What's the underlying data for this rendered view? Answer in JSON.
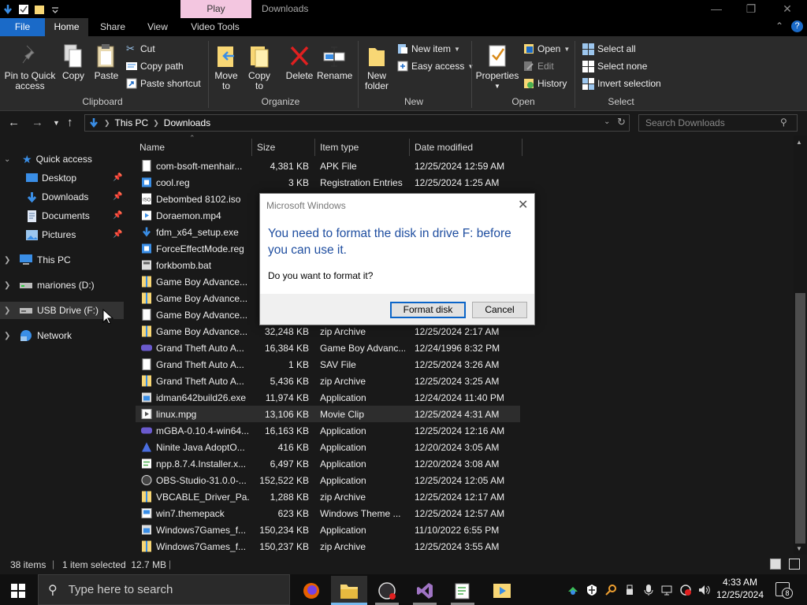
{
  "titlebar": {
    "context_tab": "Play",
    "window_title": "Downloads",
    "controls": [
      "minimize-icon",
      "restore-icon",
      "close-icon"
    ]
  },
  "tabs": {
    "file": "File",
    "home": "Home",
    "share": "Share",
    "view": "View",
    "video_tools": "Video Tools"
  },
  "ribbon": {
    "clipboard": {
      "group": "Clipboard",
      "pin_label": "Pin to Quick access",
      "pin_line1": "Pin to Quick",
      "pin_line2": "access",
      "copy": "Copy",
      "paste": "Paste",
      "cut": "Cut",
      "copy_path": "Copy path",
      "paste_shortcut": "Paste shortcut"
    },
    "organize": {
      "group": "Organize",
      "move_to_1": "Move",
      "move_to_2": "to",
      "copy_to_1": "Copy",
      "copy_to_2": "to",
      "delete": "Delete",
      "rename": "Rename"
    },
    "new": {
      "group": "New",
      "new_folder_1": "New",
      "new_folder_2": "folder",
      "new_item": "New item",
      "easy_access": "Easy access"
    },
    "open": {
      "group": "Open",
      "properties": "Properties",
      "open": "Open",
      "edit": "Edit",
      "history": "History"
    },
    "select": {
      "group": "Select",
      "select_all": "Select all",
      "select_none": "Select none",
      "invert": "Invert selection"
    }
  },
  "address": {
    "crumbs": [
      "This PC",
      "Downloads"
    ],
    "search_placeholder": "Search Downloads"
  },
  "sidebar": {
    "quick_access": "Quick access",
    "items": [
      {
        "label": "Desktop",
        "icon": "desktop-icon",
        "pinned": true
      },
      {
        "label": "Downloads",
        "icon": "download-icon",
        "pinned": true
      },
      {
        "label": "Documents",
        "icon": "documents-icon",
        "pinned": true
      },
      {
        "label": "Pictures",
        "icon": "pictures-icon",
        "pinned": true
      }
    ],
    "this_pc": "This PC",
    "drive_d": "mariones (D:)",
    "usb": "USB Drive (F:)",
    "network": "Network"
  },
  "columns": {
    "name": "Name",
    "size": "Size",
    "type": "Item type",
    "date": "Date modified"
  },
  "files": [
    {
      "name": "com-bsoft-menhair...",
      "size": "4,381 KB",
      "type": "APK File",
      "date": "12/25/2024 12:59 AM",
      "icon": "file"
    },
    {
      "name": "cool.reg",
      "size": "3 KB",
      "type": "Registration Entries",
      "date": "12/25/2024 1:25 AM",
      "icon": "reg"
    },
    {
      "name": "Debombed 8102.iso",
      "size": "",
      "type": "",
      "date": "",
      "icon": "iso"
    },
    {
      "name": "Doraemon.mp4",
      "size": "",
      "type": "",
      "date": "",
      "icon": "video"
    },
    {
      "name": "fdm_x64_setup.exe",
      "size": "",
      "type": "",
      "date": "",
      "icon": "setup"
    },
    {
      "name": "ForceEffectMode.reg",
      "size": "",
      "type": "",
      "date": "",
      "icon": "reg"
    },
    {
      "name": "forkbomb.bat",
      "size": "",
      "type": "",
      "date": "",
      "icon": "bat"
    },
    {
      "name": "Game Boy Advance...",
      "size": "",
      "type": "",
      "date": "",
      "icon": "zip"
    },
    {
      "name": "Game Boy Advance...",
      "size": "",
      "type": "",
      "date": "",
      "icon": "zip"
    },
    {
      "name": "Game Boy Advance...",
      "size": "",
      "type": "",
      "date": "",
      "icon": "file"
    },
    {
      "name": "Game Boy Advance...",
      "size": "32,248 KB",
      "type": "zip Archive",
      "date": "12/25/2024 2:17 AM",
      "icon": "zip"
    },
    {
      "name": "Grand Theft Auto A...",
      "size": "16,384 KB",
      "type": "Game Boy Advanc...",
      "date": "12/24/1996 8:32 PM",
      "icon": "gba"
    },
    {
      "name": "Grand Theft Auto A...",
      "size": "1 KB",
      "type": "SAV File",
      "date": "12/25/2024 3:26 AM",
      "icon": "file"
    },
    {
      "name": "Grand Theft Auto A...",
      "size": "5,436 KB",
      "type": "zip Archive",
      "date": "12/25/2024 3:25 AM",
      "icon": "zip"
    },
    {
      "name": "idman642build26.exe",
      "size": "11,974 KB",
      "type": "Application",
      "date": "12/24/2024 11:40 PM",
      "icon": "app"
    },
    {
      "name": "linux.mpg",
      "size": "13,106 KB",
      "type": "Movie Clip",
      "date": "12/25/2024 4:31 AM",
      "icon": "movie",
      "selected": true
    },
    {
      "name": "mGBA-0.10.4-win64...",
      "size": "16,163 KB",
      "type": "Application",
      "date": "12/25/2024 12:16 AM",
      "icon": "gba"
    },
    {
      "name": "Ninite Java AdoptO...",
      "size": "416 KB",
      "type": "Application",
      "date": "12/20/2024 3:05 AM",
      "icon": "ninite"
    },
    {
      "name": "npp.8.7.4.Installer.x...",
      "size": "6,497 KB",
      "type": "Application",
      "date": "12/20/2024 3:08 AM",
      "icon": "npp"
    },
    {
      "name": "OBS-Studio-31.0.0-...",
      "size": "152,522 KB",
      "type": "Application",
      "date": "12/25/2024 12:05 AM",
      "icon": "obs"
    },
    {
      "name": "VBCABLE_Driver_Pa...",
      "size": "1,288 KB",
      "type": "zip Archive",
      "date": "12/25/2024 12:17 AM",
      "icon": "zip"
    },
    {
      "name": "win7.themepack",
      "size": "623 KB",
      "type": "Windows Theme ...",
      "date": "12/25/2024 12:57 AM",
      "icon": "theme"
    },
    {
      "name": "Windows7Games_f...",
      "size": "150,234 KB",
      "type": "Application",
      "date": "11/10/2022 6:55 PM",
      "icon": "app"
    },
    {
      "name": "Windows7Games_f...",
      "size": "150,237 KB",
      "type": "zip Archive",
      "date": "12/25/2024 3:55 AM",
      "icon": "zip"
    }
  ],
  "statusbar": {
    "count": "38 items",
    "selection": "1 item selected  12.7 MB"
  },
  "dialog": {
    "title": "Microsoft Windows",
    "message": "You need to format the disk in drive F: before you can use it.",
    "question": "Do you want to format it?",
    "format_button": "Format disk",
    "cancel_button": "Cancel"
  },
  "taskbar": {
    "search_placeholder": "Type here to search",
    "apps": [
      "firefox-icon",
      "file-explorer-icon",
      "obs-icon",
      "visual-studio-icon",
      "notepad-plus-plus-icon",
      "media-player-icon"
    ],
    "time": "4:33 AM",
    "date": "12/25/2024",
    "notifications": "8"
  },
  "colors": {
    "accent": "#1a6ac8",
    "context_tab": "#f3c6e0",
    "dialog_heading": "#1f4ea0",
    "folder": "#f8d775"
  }
}
